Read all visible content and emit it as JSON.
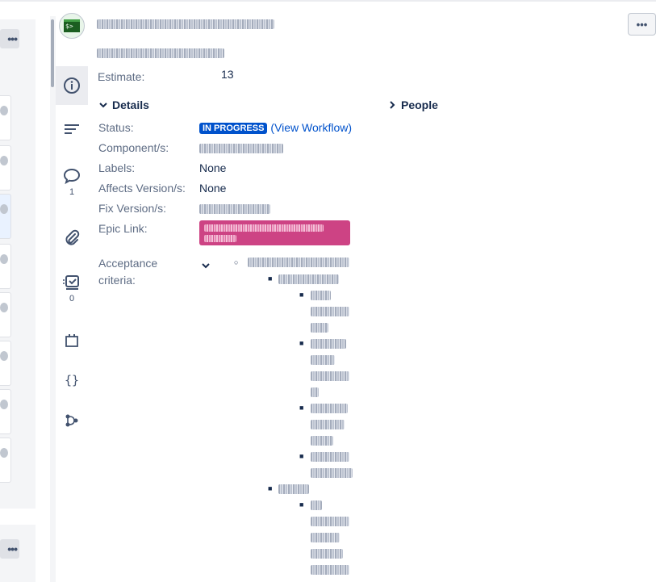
{
  "estimate": {
    "label": "Estimate:",
    "value": "13"
  },
  "details": {
    "header": "Details",
    "fields": [
      {
        "label": "Status:"
      },
      {
        "label": "Component/s:"
      },
      {
        "label": "Labels:",
        "value": "None"
      },
      {
        "label": "Affects Version/s:",
        "value": "None"
      },
      {
        "label": "Fix Version/s:"
      },
      {
        "label": "Epic Link:"
      },
      {
        "label": "Acceptance criteria:"
      }
    ],
    "status_badge": "IN PROGRESS",
    "view_workflow": "(View Workflow)"
  },
  "people": {
    "header": "People"
  },
  "nav": {
    "comments_count": "1",
    "checklist_count": "0"
  },
  "more_button": "•••",
  "board_dots": "•••",
  "colors": {
    "epic": "#cd4384",
    "status": "#0052cc"
  }
}
